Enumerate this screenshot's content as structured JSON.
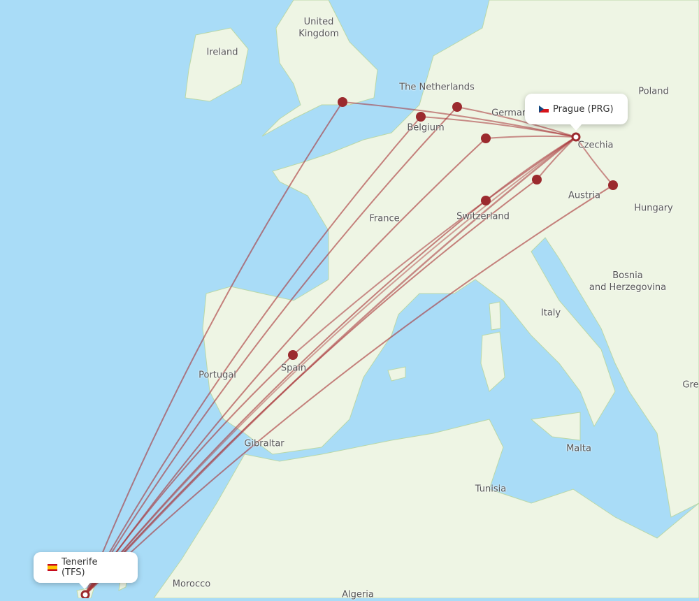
{
  "map": {
    "colors": {
      "water": "#a9dcf7",
      "land": "#eef5e4",
      "route": "#a83236",
      "hub": "#9b2a2e"
    },
    "labels": [
      {
        "text": "United\nKingdom",
        "name": "label-united-kingdom"
      },
      {
        "text": "Ireland",
        "name": "label-ireland"
      },
      {
        "text": "The Netherlands",
        "name": "label-netherlands"
      },
      {
        "text": "Germany",
        "name": "label-germany"
      },
      {
        "text": "Poland",
        "name": "label-poland"
      },
      {
        "text": "Belgium",
        "name": "label-belgium"
      },
      {
        "text": "Czechia",
        "name": "label-czechia"
      },
      {
        "text": "Austria",
        "name": "label-austria"
      },
      {
        "text": "Hungary",
        "name": "label-hungary"
      },
      {
        "text": "France",
        "name": "label-france"
      },
      {
        "text": "Switzerland",
        "name": "label-switzerland"
      },
      {
        "text": "Bosnia\nand Herzegovina",
        "name": "label-bosnia"
      },
      {
        "text": "Italy",
        "name": "label-italy"
      },
      {
        "text": "Portugal",
        "name": "label-portugal"
      },
      {
        "text": "Spain",
        "name": "label-spain"
      },
      {
        "text": "Gibraltar",
        "name": "label-gibraltar"
      },
      {
        "text": "Malta",
        "name": "label-malta"
      },
      {
        "text": "Tunisia",
        "name": "label-tunisia"
      },
      {
        "text": "Morocco",
        "name": "label-morocco"
      },
      {
        "text": "Algeria",
        "name": "label-algeria"
      },
      {
        "text": "Gre",
        "name": "label-greece"
      }
    ],
    "origin": {
      "label": "Prague (PRG)",
      "flag": "cz-flag-icon"
    },
    "destination": {
      "label": "Tenerife (TFS)",
      "flag": "es-flag-icon"
    }
  }
}
